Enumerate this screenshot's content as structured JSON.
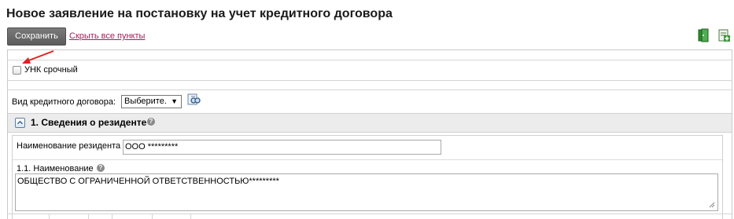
{
  "page": {
    "title": "Новое заявление на постановку на учет кредитного договора"
  },
  "toolbar": {
    "save_label": "Сохранить",
    "hide_all_label": "Скрыть все пункты",
    "icons": [
      "exit-door-icon",
      "add-document-icon"
    ]
  },
  "form": {
    "urgent_checkbox": {
      "label": "УНК срочный",
      "checked": false
    },
    "contract_kind": {
      "label": "Вид кредитного договора:",
      "selected": "Выберите."
    },
    "section1": {
      "title": "1. Сведения о резиденте",
      "resident_name": {
        "label": "Наименование резидента",
        "value": "ООО *********"
      },
      "full_name": {
        "label": "1.1. Наименование",
        "value": "ОБЩЕСТВО С ОГРАНИЧЕННОЙ ОТВЕТСТВЕННОСТЬЮ*********"
      }
    }
  },
  "colors": {
    "link": "#a0205a",
    "save_button": "#666666",
    "section_header_bg": "#ececec",
    "annotation_arrow": "#e02020"
  }
}
